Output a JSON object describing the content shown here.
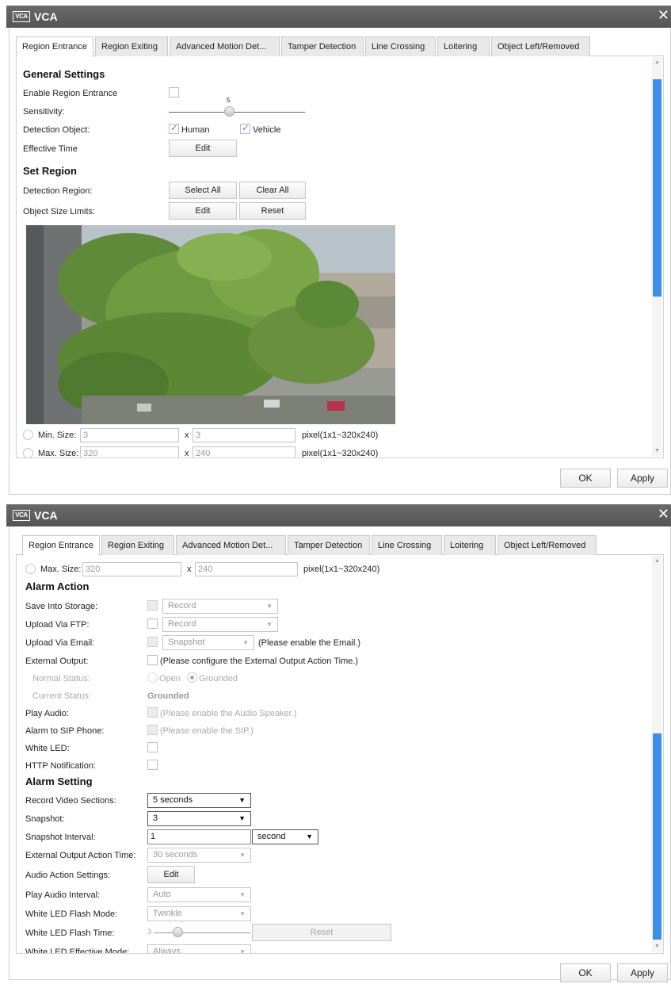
{
  "dialog": {
    "title": "VCA",
    "logo": "VCA",
    "close_icon": "✕",
    "ok_label": "OK",
    "apply_label": "Apply"
  },
  "tabs": [
    {
      "label": "Region Entrance",
      "active": true
    },
    {
      "label": "Region Exiting",
      "active": false
    },
    {
      "label": "Advanced Motion Det...",
      "active": false
    },
    {
      "label": "Tamper Detection",
      "active": false
    },
    {
      "label": "Line Crossing",
      "active": false
    },
    {
      "label": "Loitering",
      "active": false
    },
    {
      "label": "Object Left/Removed",
      "active": false
    }
  ],
  "general": {
    "heading": "General Settings",
    "enable_label": "Enable Region Entrance",
    "enable_checked": false,
    "sensitivity_label": "Sensitivity:",
    "sensitivity_value": "5",
    "sensitivity_level_fraction": 0.5,
    "detection_object_label": "Detection Object:",
    "human_label": "Human",
    "human_checked": true,
    "vehicle_label": "Vehicle",
    "vehicle_checked": true,
    "effective_time_label": "Effective Time",
    "edit_label": "Edit"
  },
  "region": {
    "heading": "Set Region",
    "detection_region_label": "Detection Region:",
    "select_all_label": "Select All",
    "clear_all_label": "Clear All",
    "object_size_label": "Object Size Limits:",
    "edit_label": "Edit",
    "reset_label": "Reset",
    "min_label": "Min. Size:",
    "min_w": "3",
    "min_h": "3",
    "max_label": "Max. Size:",
    "max_w": "320",
    "max_h": "240",
    "times": "x",
    "range_hint": "pixel(1x1~320x240)"
  },
  "alarm_action": {
    "heading": "Alarm Action",
    "save_storage_label": "Save Into Storage:",
    "save_storage_value": "Record",
    "upload_ftp_label": "Upload Via FTP:",
    "upload_ftp_value": "Record",
    "upload_email_label": "Upload Via Email:",
    "upload_email_value": "Snapshot",
    "upload_email_hint": "(Please enable the Email.)",
    "external_output_label": "External Output:",
    "external_output_hint": "(Please configure the External Output Action Time.)",
    "normal_status_label": "Normal Status:",
    "open_label": "Open",
    "grounded_label": "Grounded",
    "current_status_label": "Current Status:",
    "current_status_value": "Grounded",
    "play_audio_label": "Play Audio:",
    "play_audio_hint": "(Please enable the Audio Speaker.)",
    "sip_label": "Alarm to SIP Phone:",
    "sip_hint": "(Please enable the SIP.)",
    "white_led_label": "White LED:",
    "http_label": "HTTP Notification:"
  },
  "alarm_setting": {
    "heading": "Alarm Setting",
    "record_sections_label": "Record Video Sections:",
    "record_sections_value": "5 seconds",
    "snapshot_label": "Snapshot:",
    "snapshot_value": "3",
    "snapshot_interval_label": "Snapshot Interval:",
    "snapshot_interval_value": "1",
    "snapshot_interval_unit": "second",
    "ext_action_time_label": "External Output Action Time:",
    "ext_action_time_value": "30 seconds",
    "audio_action_label": "Audio Action Settings:",
    "audio_action_button": "Edit",
    "play_audio_interval_label": "Play Audio Interval:",
    "play_audio_interval_value": "Auto",
    "led_flash_mode_label": "White LED Flash Mode:",
    "led_flash_mode_value": "Twinkle",
    "led_flash_time_label": "White LED Flash Time:",
    "led_flash_time_value": "3",
    "led_flash_time_fraction": 0.25,
    "reset_label": "Reset",
    "led_effective_mode_label": "White LED Effective Mode:",
    "led_effective_mode_value": "Always"
  },
  "scrollbar": {
    "top_pane_position": 0.0,
    "top_pane_visible": 0.55,
    "bottom_pane_position": 0.45,
    "bottom_pane_visible": 0.55
  },
  "colors": {
    "accent": "#3e8ee8",
    "titlebar": "#5c5c5c",
    "checkmark": "#3d8ae3"
  }
}
